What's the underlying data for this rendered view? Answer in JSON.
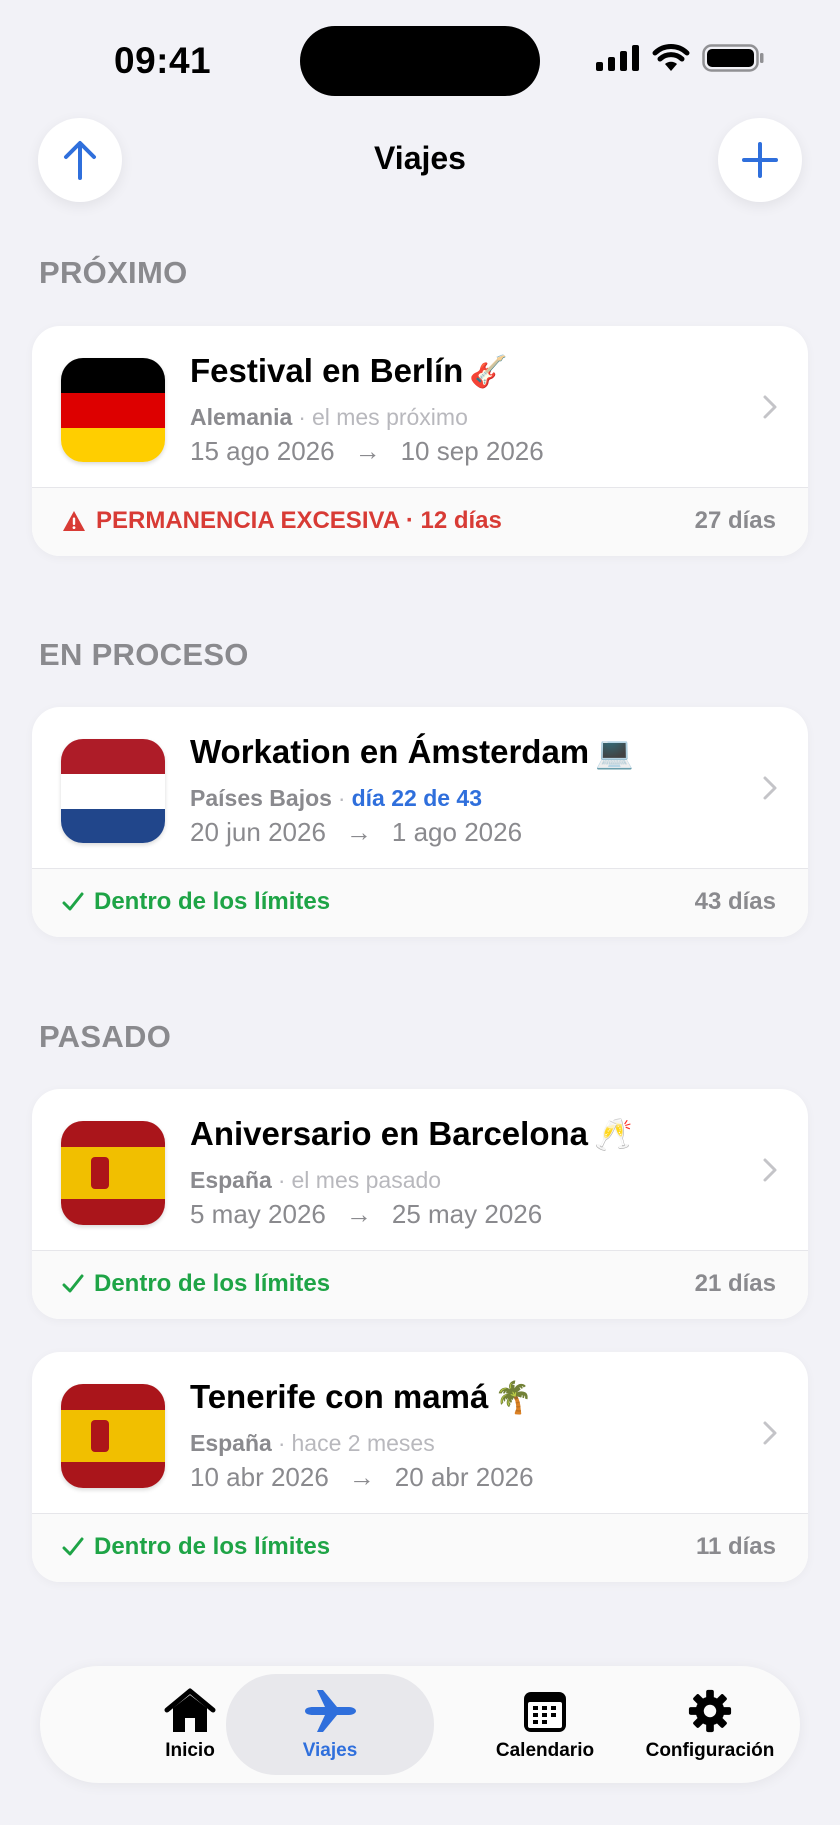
{
  "status_bar": {
    "time": "09:41"
  },
  "nav": {
    "title": "Viajes"
  },
  "sections": {
    "upcoming": {
      "title": "PRÓXIMO"
    },
    "in_progress": {
      "title": "EN PROCESO"
    },
    "past": {
      "title": "PASADO"
    }
  },
  "trips": [
    {
      "title": "Festival en Berlín",
      "emoji": "🎸",
      "country": "Alemania",
      "relative": "el mes próximo",
      "start": "15 ago 2026",
      "end": "10 sep 2026",
      "status": "PERMANENCIA EXCESIVA · 12 días",
      "days": "27 días",
      "flag_colors": [
        "#000000",
        "#dd0000",
        "#ffce00"
      ]
    },
    {
      "title": "Workation en Ámsterdam",
      "emoji": "💻",
      "country": "Países Bajos",
      "relative": "día 22 de 43",
      "start": "20 jun 2026",
      "end": "1 ago 2026",
      "status": "Dentro de los límites",
      "days": "43 días",
      "flag_colors": [
        "#ae1c28",
        "#ffffff",
        "#21468b"
      ]
    },
    {
      "title": "Aniversario en Barcelona",
      "emoji": "🥂",
      "country": "España",
      "relative": "el mes pasado",
      "start": "5 may 2026",
      "end": "25 may 2026",
      "status": "Dentro de los límites",
      "days": "21 días",
      "flag_colors": [
        "#aa151b",
        "#f1bf00",
        "#aa151b"
      ]
    },
    {
      "title": "Tenerife con mamá",
      "emoji": "🌴",
      "country": "España",
      "relative": "hace 2 meses",
      "start": "10 abr 2026",
      "end": "20 abr 2026",
      "status": "Dentro de los límites",
      "days": "11 días",
      "flag_colors": [
        "#aa151b",
        "#f1bf00",
        "#aa151b"
      ]
    }
  ],
  "date_arrow": "→",
  "tabbar": {
    "tabs": [
      {
        "label": "Inicio",
        "icon": "house-icon"
      },
      {
        "label": "Viajes",
        "icon": "airplane-icon",
        "active": true
      },
      {
        "label": "Calendario",
        "icon": "calendar-icon"
      },
      {
        "label": "Configuración",
        "icon": "gear-icon"
      }
    ]
  },
  "colors": {
    "accent": "#2f6fdc",
    "ok": "#1ea446",
    "warn": "#d83b35",
    "secondary": "#8a8a8e"
  }
}
